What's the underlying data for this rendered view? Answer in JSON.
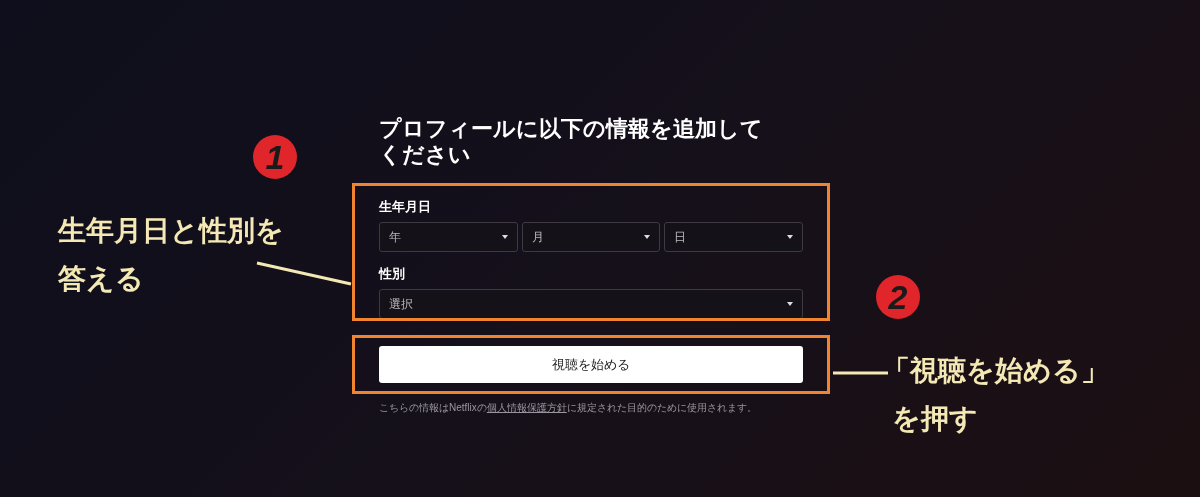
{
  "form": {
    "title_lines": [
      "プロフィールに以下の情報を追加して",
      "ください"
    ],
    "birthday": {
      "label": "生年月日",
      "selects": [
        {
          "placeholder": "年"
        },
        {
          "placeholder": "月"
        },
        {
          "placeholder": "日"
        }
      ]
    },
    "gender": {
      "label": "性別",
      "select": {
        "placeholder": "選択"
      }
    },
    "submit_button": "視聴を始める",
    "footer": {
      "before": "こちらの情報はNetflixの",
      "link": "個人情報保護方針",
      "after": "に規定された目的のために使用されます。"
    }
  },
  "annotations": [
    {
      "number": "1",
      "lines": [
        "生年月日と性別を",
        "答える"
      ]
    },
    {
      "number": "2",
      "lines": [
        "「視聴を始める」",
        "を押す"
      ]
    }
  ]
}
